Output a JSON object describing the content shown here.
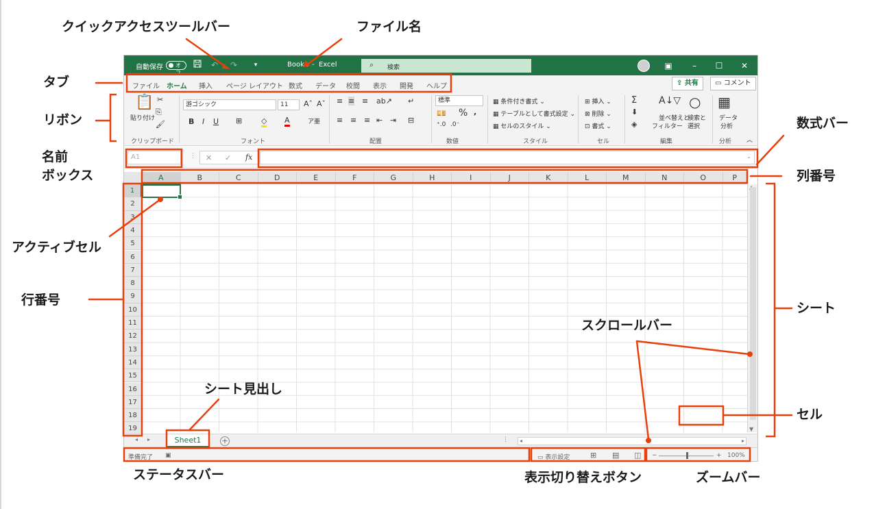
{
  "titlebar": {
    "autosave_label": "自動保存",
    "autosave_state": "オフ",
    "filename": "Book1",
    "app_sep": "-",
    "app_name": "Excel",
    "search_placeholder": "検索",
    "save_icon": "save-icon",
    "undo_icon": "undo-icon",
    "redo_icon": "redo-icon"
  },
  "tabs": [
    "ファイル",
    "ホーム",
    "挿入",
    "ページ レイアウト",
    "数式",
    "データ",
    "校閲",
    "表示",
    "開発",
    "ヘルプ"
  ],
  "active_tab": "ホーム",
  "share_button": "共有",
  "comment_button": "コメント",
  "ribbon": {
    "clipboard": {
      "name": "クリップボード",
      "paste": "貼り付け"
    },
    "font": {
      "name": "フォント",
      "font_name": "游ゴシック",
      "font_size": "11"
    },
    "alignment": {
      "name": "配置"
    },
    "number": {
      "name": "数値",
      "format": "標準"
    },
    "styles": {
      "name": "スタイル",
      "conditional": "条件付き書式",
      "table": "テーブルとして書式設定",
      "cell_styles": "セルのスタイル"
    },
    "cells": {
      "name": "セル",
      "insert": "挿入",
      "delete": "削除",
      "format": "書式"
    },
    "editing": {
      "name": "編集",
      "sort1": "並べ替えと",
      "sort2": "フィルター",
      "find1": "検索と",
      "find2": "選択"
    },
    "analysis": {
      "name": "分析",
      "data1": "データ",
      "data2": "分析"
    }
  },
  "formula_bar": {
    "namebox": "A1",
    "fx": "fx"
  },
  "columns": [
    "A",
    "B",
    "C",
    "D",
    "E",
    "F",
    "G",
    "H",
    "I",
    "J",
    "K",
    "L",
    "M",
    "N",
    "O",
    "P"
  ],
  "rows": [
    "1",
    "2",
    "3",
    "4",
    "5",
    "6",
    "7",
    "8",
    "9",
    "10",
    "11",
    "12",
    "13",
    "14",
    "15",
    "16",
    "17",
    "18",
    "19"
  ],
  "sheet_tab": "Sheet1",
  "status": {
    "ready": "準備完了",
    "display_settings": "表示設定",
    "zoom": "100%"
  },
  "labels": {
    "quick_access": "クイックアクセスツールバー",
    "filename": "ファイル名",
    "tabs": "タブ",
    "ribbon": "リボン",
    "namebox_1": "名前",
    "namebox_2": "ボックス",
    "formula_bar": "数式バー",
    "column_numbers": "列番号",
    "active_cell": "アクティブセル",
    "row_numbers": "行番号",
    "sheet": "シート",
    "scrollbar": "スクロールバー",
    "sheet_tab": "シート見出し",
    "cell": "セル",
    "status_bar": "ステータスバー",
    "view_buttons": "表示切り替えボタン",
    "zoom_bar": "ズームバー"
  },
  "colors": {
    "excel_green": "#217346",
    "annotation": "#e8400c"
  }
}
